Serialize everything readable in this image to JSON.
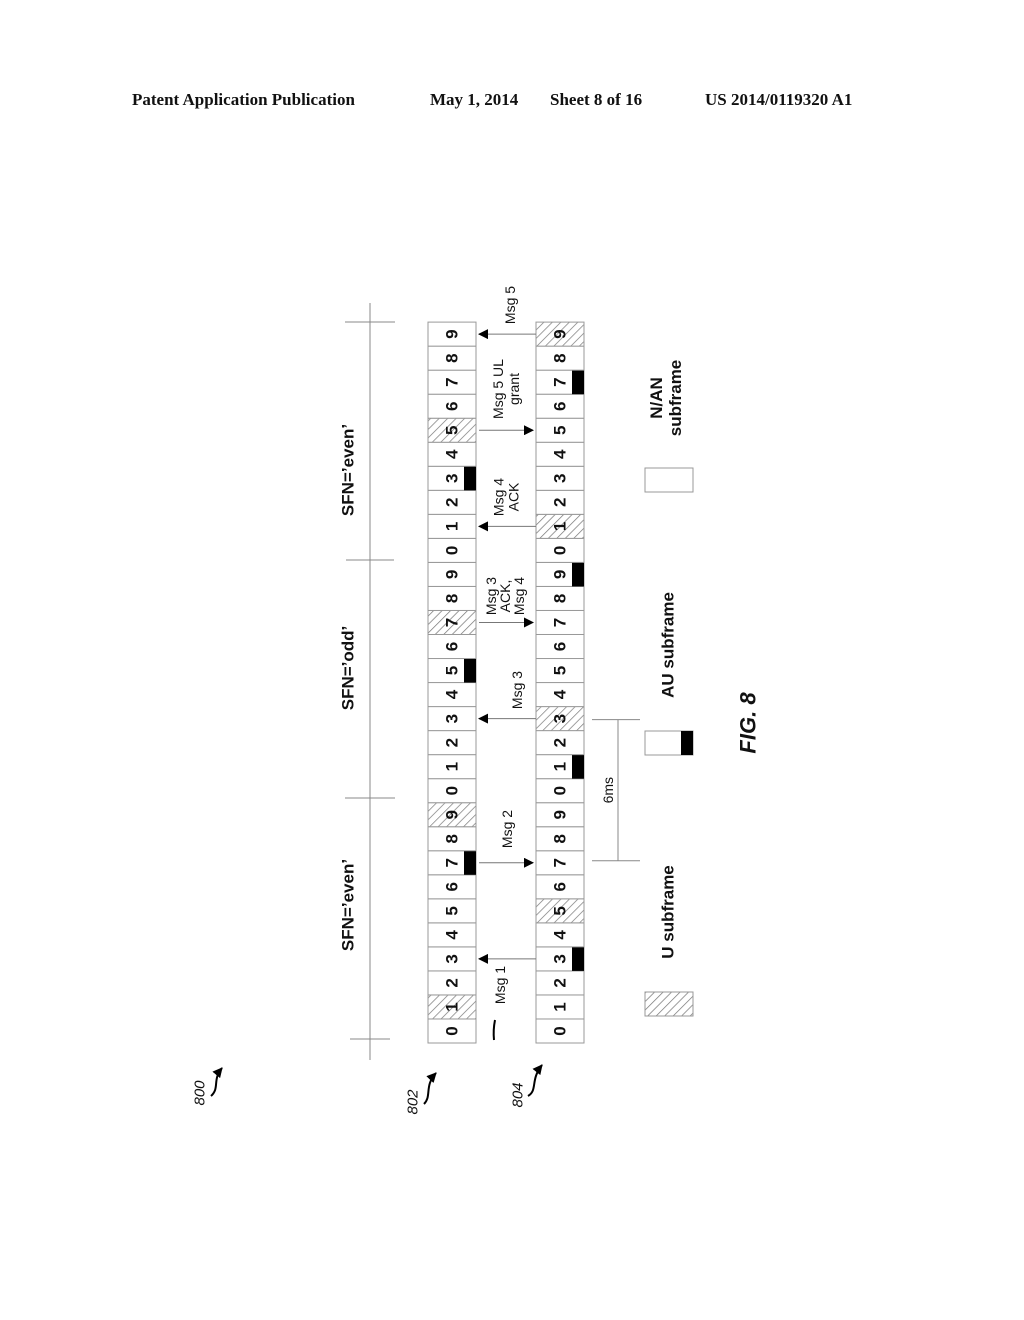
{
  "header": {
    "publication": "Patent Application Publication",
    "date": "May 1, 2014",
    "sheet": "Sheet 8 of 16",
    "number": "US 2014/0119320 A1"
  },
  "figure": {
    "label": "FIG. 8",
    "ref_diagram": "800",
    "ref_row_top": "802",
    "ref_row_bottom": "804"
  },
  "frames": [
    {
      "label": "SFN=’even’"
    },
    {
      "label": "SFN=’odd’"
    },
    {
      "label": "SFN=’even’"
    }
  ],
  "rows": [
    {
      "id": "802",
      "subframes": [
        {
          "n": "0",
          "type": "N/AN"
        },
        {
          "n": "1",
          "type": "U"
        },
        {
          "n": "2",
          "type": "N/AN"
        },
        {
          "n": "3",
          "type": "N/AN"
        },
        {
          "n": "4",
          "type": "N/AN"
        },
        {
          "n": "5",
          "type": "N/AN"
        },
        {
          "n": "6",
          "type": "N/AN"
        },
        {
          "n": "7",
          "type": "AU"
        },
        {
          "n": "8",
          "type": "N/AN"
        },
        {
          "n": "9",
          "type": "U"
        },
        {
          "n": "0",
          "type": "N/AN"
        },
        {
          "n": "1",
          "type": "N/AN"
        },
        {
          "n": "2",
          "type": "N/AN"
        },
        {
          "n": "3",
          "type": "N/AN"
        },
        {
          "n": "4",
          "type": "N/AN"
        },
        {
          "n": "5",
          "type": "AU"
        },
        {
          "n": "6",
          "type": "N/AN"
        },
        {
          "n": "7",
          "type": "U"
        },
        {
          "n": "8",
          "type": "N/AN"
        },
        {
          "n": "9",
          "type": "N/AN"
        },
        {
          "n": "0",
          "type": "N/AN"
        },
        {
          "n": "1",
          "type": "N/AN"
        },
        {
          "n": "2",
          "type": "N/AN"
        },
        {
          "n": "3",
          "type": "AU"
        },
        {
          "n": "4",
          "type": "N/AN"
        },
        {
          "n": "5",
          "type": "U"
        },
        {
          "n": "6",
          "type": "N/AN"
        },
        {
          "n": "7",
          "type": "N/AN"
        },
        {
          "n": "8",
          "type": "N/AN"
        },
        {
          "n": "9",
          "type": "N/AN"
        }
      ]
    },
    {
      "id": "804",
      "subframes": [
        {
          "n": "0",
          "type": "N/AN"
        },
        {
          "n": "1",
          "type": "N/AN"
        },
        {
          "n": "2",
          "type": "N/AN"
        },
        {
          "n": "3",
          "type": "AU"
        },
        {
          "n": "4",
          "type": "N/AN"
        },
        {
          "n": "5",
          "type": "U"
        },
        {
          "n": "6",
          "type": "N/AN"
        },
        {
          "n": "7",
          "type": "N/AN"
        },
        {
          "n": "8",
          "type": "N/AN"
        },
        {
          "n": "9",
          "type": "N/AN"
        },
        {
          "n": "0",
          "type": "N/AN"
        },
        {
          "n": "1",
          "type": "AU"
        },
        {
          "n": "2",
          "type": "N/AN"
        },
        {
          "n": "3",
          "type": "U"
        },
        {
          "n": "4",
          "type": "N/AN"
        },
        {
          "n": "5",
          "type": "N/AN"
        },
        {
          "n": "6",
          "type": "N/AN"
        },
        {
          "n": "7",
          "type": "N/AN"
        },
        {
          "n": "8",
          "type": "N/AN"
        },
        {
          "n": "9",
          "type": "AU"
        },
        {
          "n": "0",
          "type": "N/AN"
        },
        {
          "n": "1",
          "type": "U"
        },
        {
          "n": "2",
          "type": "N/AN"
        },
        {
          "n": "3",
          "type": "N/AN"
        },
        {
          "n": "4",
          "type": "N/AN"
        },
        {
          "n": "5",
          "type": "N/AN"
        },
        {
          "n": "6",
          "type": "N/AN"
        },
        {
          "n": "7",
          "type": "AU"
        },
        {
          "n": "8",
          "type": "N/AN"
        },
        {
          "n": "9",
          "type": "U"
        }
      ]
    }
  ],
  "messages": [
    {
      "lines": [
        "Msg 1"
      ],
      "subframe_index": 3,
      "direction": "804-to-802"
    },
    {
      "lines": [
        "Msg 2"
      ],
      "subframe_index": 7,
      "direction": "802-to-804"
    },
    {
      "lines": [
        "Msg 3"
      ],
      "subframe_index": 13,
      "direction": "804-to-802"
    },
    {
      "lines": [
        "Msg 3",
        "ACK,",
        "Msg 4"
      ],
      "subframe_index": 17,
      "direction": "802-to-804"
    },
    {
      "lines": [
        "Msg 4",
        "ACK"
      ],
      "subframe_index": 21,
      "direction": "804-to-802"
    },
    {
      "lines": [
        "Msg 5 UL",
        "grant"
      ],
      "subframe_index": 25,
      "direction": "802-to-804"
    },
    {
      "lines": [
        "Msg 5"
      ],
      "subframe_index": 29,
      "direction": "804-to-802"
    }
  ],
  "interval": {
    "label": "6ms",
    "from_subframe": 7,
    "to_subframe": 13
  },
  "legend": [
    {
      "type": "U",
      "label_lines": [
        "U subframe"
      ]
    },
    {
      "type": "AU",
      "label_lines": [
        "AU subframe"
      ]
    },
    {
      "type": "N/AN",
      "label_lines": [
        "N/AN",
        "subframe"
      ]
    }
  ]
}
